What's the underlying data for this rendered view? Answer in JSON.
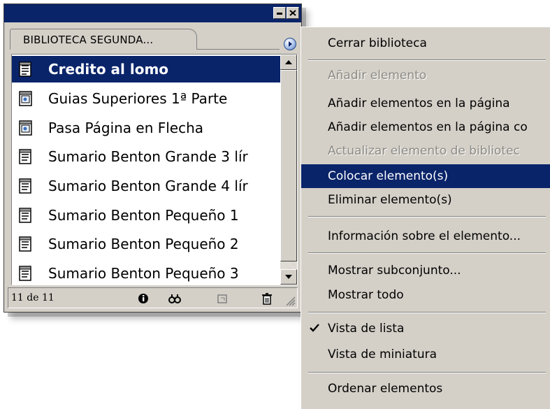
{
  "panel": {
    "tab_label": "BIBLIOTECA SEGUNDA...",
    "items": [
      {
        "label": "Credito al lomo",
        "icon": "text-document-icon",
        "selected": true
      },
      {
        "label": "Guias Superiores 1ª Parte",
        "icon": "graphic-document-icon"
      },
      {
        "label": "Pasa Página en Flecha",
        "icon": "graphic-document-icon"
      },
      {
        "label": "Sumario Benton Grande 3 lír",
        "icon": "text-document-icon"
      },
      {
        "label": "Sumario Benton Grande 4 lír",
        "icon": "text-document-icon"
      },
      {
        "label": "Sumario Benton Pequeño 1",
        "icon": "text-document-icon"
      },
      {
        "label": "Sumario Benton Pequeño 2",
        "icon": "text-document-icon"
      },
      {
        "label": "Sumario Benton Pequeño 3",
        "icon": "text-document-icon"
      }
    ],
    "status_count": "11 de 11"
  },
  "menu": {
    "items": [
      {
        "label": "Cerrar biblioteca",
        "state": "normal"
      },
      {
        "label": "Añadir elemento",
        "state": "disabled"
      },
      {
        "label": "Añadir elementos en la página",
        "state": "normal"
      },
      {
        "label": "Añadir elementos en la página co",
        "state": "normal"
      },
      {
        "label": "Actualizar elemento de bibliotec",
        "state": "disabled"
      },
      {
        "label": "Colocar elemento(s)",
        "state": "highlighted"
      },
      {
        "label": "Eliminar elemento(s)",
        "state": "normal"
      },
      {
        "label": "Información sobre el elemento...",
        "state": "normal"
      },
      {
        "label": "Mostrar subconjunto...",
        "state": "normal"
      },
      {
        "label": "Mostrar todo",
        "state": "normal"
      },
      {
        "label": "Vista de lista",
        "state": "checked"
      },
      {
        "label": "Vista de miniatura",
        "state": "normal"
      },
      {
        "label": "Ordenar elementos",
        "state": "normal"
      }
    ]
  },
  "colors": {
    "selection": "#0a246a",
    "face": "#d4d0c8",
    "disabled_text": "#8c8a84"
  }
}
